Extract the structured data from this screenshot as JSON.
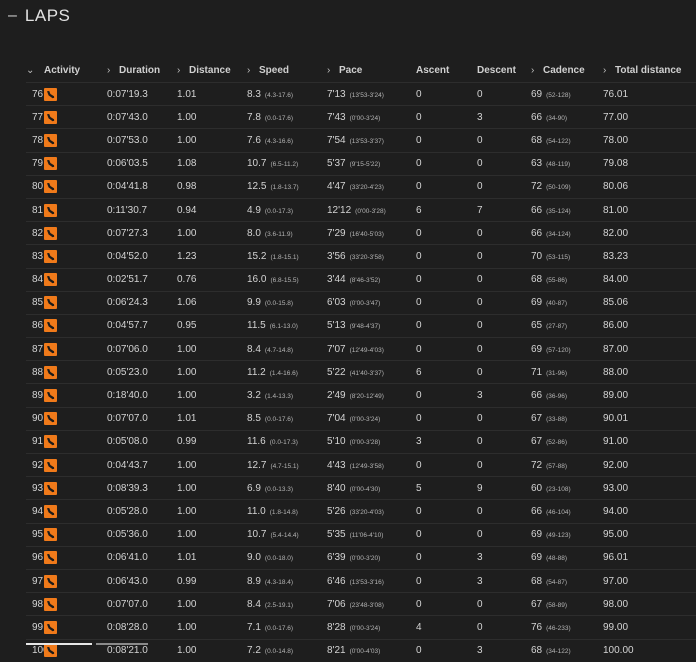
{
  "section": {
    "title": "LAPS"
  },
  "columns": {
    "activity": "Activity",
    "duration": "Duration",
    "distance": "Distance",
    "speed": "Speed",
    "pace": "Pace",
    "ascent": "Ascent",
    "descent": "Descent",
    "cadence": "Cadence",
    "total_distance": "Total distance"
  },
  "icons": {
    "activity": "running-shoe-icon",
    "sort": "chevron-down-icon",
    "column": "chevron-right-icon"
  },
  "colors": {
    "activity_badge": "#f07a1a",
    "background": "#1e1e1e"
  },
  "rows": [
    {
      "lap": "76",
      "duration": "0:07'19.3",
      "distance": "1.01",
      "speed": "8.3",
      "speed_range": "(4.3-17.6)",
      "pace": "7'13",
      "pace_range": "(13'53-3'24)",
      "ascent": "0",
      "descent": "0",
      "cadence": "69",
      "cadence_range": "(52-128)",
      "total": "76.01"
    },
    {
      "lap": "77",
      "duration": "0:07'43.0",
      "distance": "1.00",
      "speed": "7.8",
      "speed_range": "(0.0-17.6)",
      "pace": "7'43",
      "pace_range": "(0'00-3'24)",
      "ascent": "0",
      "descent": "3",
      "cadence": "66",
      "cadence_range": "(34-90)",
      "total": "77.00"
    },
    {
      "lap": "78",
      "duration": "0:07'53.0",
      "distance": "1.00",
      "speed": "7.6",
      "speed_range": "(4.3-16.6)",
      "pace": "7'54",
      "pace_range": "(13'53-3'37)",
      "ascent": "0",
      "descent": "0",
      "cadence": "68",
      "cadence_range": "(54-122)",
      "total": "78.00"
    },
    {
      "lap": "79",
      "duration": "0:06'03.5",
      "distance": "1.08",
      "speed": "10.7",
      "speed_range": "(6.5-11.2)",
      "pace": "5'37",
      "pace_range": "(9'15-5'22)",
      "ascent": "0",
      "descent": "0",
      "cadence": "63",
      "cadence_range": "(48-119)",
      "total": "79.08"
    },
    {
      "lap": "80",
      "duration": "0:04'41.8",
      "distance": "0.98",
      "speed": "12.5",
      "speed_range": "(1.8-13.7)",
      "pace": "4'47",
      "pace_range": "(33'20-4'23)",
      "ascent": "0",
      "descent": "0",
      "cadence": "72",
      "cadence_range": "(50-109)",
      "total": "80.06"
    },
    {
      "lap": "81",
      "duration": "0:11'30.7",
      "distance": "0.94",
      "speed": "4.9",
      "speed_range": "(0.0-17.3)",
      "pace": "12'12",
      "pace_range": "(0'00-3'28)",
      "ascent": "6",
      "descent": "7",
      "cadence": "66",
      "cadence_range": "(35-124)",
      "total": "81.00"
    },
    {
      "lap": "82",
      "duration": "0:07'27.3",
      "distance": "1.00",
      "speed": "8.0",
      "speed_range": "(3.6-11.9)",
      "pace": "7'29",
      "pace_range": "(16'40-5'03)",
      "ascent": "0",
      "descent": "0",
      "cadence": "66",
      "cadence_range": "(34-124)",
      "total": "82.00"
    },
    {
      "lap": "83",
      "duration": "0:04'52.0",
      "distance": "1.23",
      "speed": "15.2",
      "speed_range": "(1.8-15.1)",
      "pace": "3'56",
      "pace_range": "(33'20-3'58)",
      "ascent": "0",
      "descent": "0",
      "cadence": "70",
      "cadence_range": "(53-115)",
      "total": "83.23"
    },
    {
      "lap": "84",
      "duration": "0:02'51.7",
      "distance": "0.76",
      "speed": "16.0",
      "speed_range": "(6.8-15.5)",
      "pace": "3'44",
      "pace_range": "(8'46-3'52)",
      "ascent": "0",
      "descent": "0",
      "cadence": "68",
      "cadence_range": "(55-86)",
      "total": "84.00"
    },
    {
      "lap": "85",
      "duration": "0:06'24.3",
      "distance": "1.06",
      "speed": "9.9",
      "speed_range": "(0.0-15.8)",
      "pace": "6'03",
      "pace_range": "(0'00-3'47)",
      "ascent": "0",
      "descent": "0",
      "cadence": "69",
      "cadence_range": "(40-87)",
      "total": "85.06"
    },
    {
      "lap": "86",
      "duration": "0:04'57.7",
      "distance": "0.95",
      "speed": "11.5",
      "speed_range": "(6.1-13.0)",
      "pace": "5'13",
      "pace_range": "(9'48-4'37)",
      "ascent": "0",
      "descent": "0",
      "cadence": "65",
      "cadence_range": "(27-87)",
      "total": "86.00"
    },
    {
      "lap": "87",
      "duration": "0:07'06.0",
      "distance": "1.00",
      "speed": "8.4",
      "speed_range": "(4.7-14.8)",
      "pace": "7'07",
      "pace_range": "(12'49-4'03)",
      "ascent": "0",
      "descent": "0",
      "cadence": "69",
      "cadence_range": "(57-120)",
      "total": "87.00"
    },
    {
      "lap": "88",
      "duration": "0:05'23.0",
      "distance": "1.00",
      "speed": "11.2",
      "speed_range": "(1.4-16.6)",
      "pace": "5'22",
      "pace_range": "(41'40-3'37)",
      "ascent": "6",
      "descent": "0",
      "cadence": "71",
      "cadence_range": "(31-96)",
      "total": "88.00"
    },
    {
      "lap": "89",
      "duration": "0:18'40.0",
      "distance": "1.00",
      "speed": "3.2",
      "speed_range": "(1.4-13.3)",
      "pace": "2'49",
      "pace_range": "(8'20-12'49)",
      "ascent": "0",
      "descent": "3",
      "cadence": "66",
      "cadence_range": "(36-96)",
      "total": "89.00"
    },
    {
      "lap": "90",
      "duration": "0:07'07.0",
      "distance": "1.01",
      "speed": "8.5",
      "speed_range": "(0.0-17.6)",
      "pace": "7'04",
      "pace_range": "(0'00-3'24)",
      "ascent": "0",
      "descent": "0",
      "cadence": "67",
      "cadence_range": "(33-88)",
      "total": "90.01"
    },
    {
      "lap": "91",
      "duration": "0:05'08.0",
      "distance": "0.99",
      "speed": "11.6",
      "speed_range": "(0.0-17.3)",
      "pace": "5'10",
      "pace_range": "(0'00-3'28)",
      "ascent": "3",
      "descent": "0",
      "cadence": "67",
      "cadence_range": "(52-86)",
      "total": "91.00"
    },
    {
      "lap": "92",
      "duration": "0:04'43.7",
      "distance": "1.00",
      "speed": "12.7",
      "speed_range": "(4.7-15.1)",
      "pace": "4'43",
      "pace_range": "(12'49-3'58)",
      "ascent": "0",
      "descent": "0",
      "cadence": "72",
      "cadence_range": "(57-88)",
      "total": "92.00"
    },
    {
      "lap": "93",
      "duration": "0:08'39.3",
      "distance": "1.00",
      "speed": "6.9",
      "speed_range": "(0.0-13.3)",
      "pace": "8'40",
      "pace_range": "(0'00-4'30)",
      "ascent": "5",
      "descent": "9",
      "cadence": "60",
      "cadence_range": "(23-108)",
      "total": "93.00"
    },
    {
      "lap": "94",
      "duration": "0:05'28.0",
      "distance": "1.00",
      "speed": "11.0",
      "speed_range": "(1.8-14.8)",
      "pace": "5'26",
      "pace_range": "(33'20-4'03)",
      "ascent": "0",
      "descent": "0",
      "cadence": "66",
      "cadence_range": "(46-104)",
      "total": "94.00"
    },
    {
      "lap": "95",
      "duration": "0:05'36.0",
      "distance": "1.00",
      "speed": "10.7",
      "speed_range": "(5.4-14.4)",
      "pace": "5'35",
      "pace_range": "(11'06-4'10)",
      "ascent": "0",
      "descent": "0",
      "cadence": "69",
      "cadence_range": "(49-123)",
      "total": "95.00"
    },
    {
      "lap": "96",
      "duration": "0:06'41.0",
      "distance": "1.01",
      "speed": "9.0",
      "speed_range": "(0.0-18.0)",
      "pace": "6'39",
      "pace_range": "(0'00-3'20)",
      "ascent": "0",
      "descent": "3",
      "cadence": "69",
      "cadence_range": "(48-88)",
      "total": "96.01"
    },
    {
      "lap": "97",
      "duration": "0:06'43.0",
      "distance": "0.99",
      "speed": "8.9",
      "speed_range": "(4.3-18.4)",
      "pace": "6'46",
      "pace_range": "(13'53-3'16)",
      "ascent": "0",
      "descent": "3",
      "cadence": "68",
      "cadence_range": "(54-87)",
      "total": "97.00"
    },
    {
      "lap": "98",
      "duration": "0:07'07.0",
      "distance": "1.00",
      "speed": "8.4",
      "speed_range": "(2.5-19.1)",
      "pace": "7'06",
      "pace_range": "(23'48-3'08)",
      "ascent": "0",
      "descent": "0",
      "cadence": "67",
      "cadence_range": "(58-89)",
      "total": "98.00"
    },
    {
      "lap": "99",
      "duration": "0:08'28.0",
      "distance": "1.00",
      "speed": "7.1",
      "speed_range": "(0.0-17.6)",
      "pace": "8'28",
      "pace_range": "(0'00-3'24)",
      "ascent": "4",
      "descent": "0",
      "cadence": "76",
      "cadence_range": "(46-233)",
      "total": "99.00"
    },
    {
      "lap": "100",
      "duration": "0:08'21.0",
      "distance": "1.00",
      "speed": "7.2",
      "speed_range": "(0.0-14.8)",
      "pace": "8'21",
      "pace_range": "(0'00-4'03)",
      "ascent": "0",
      "descent": "3",
      "cadence": "68",
      "cadence_range": "(34-122)",
      "total": "100.00"
    }
  ]
}
